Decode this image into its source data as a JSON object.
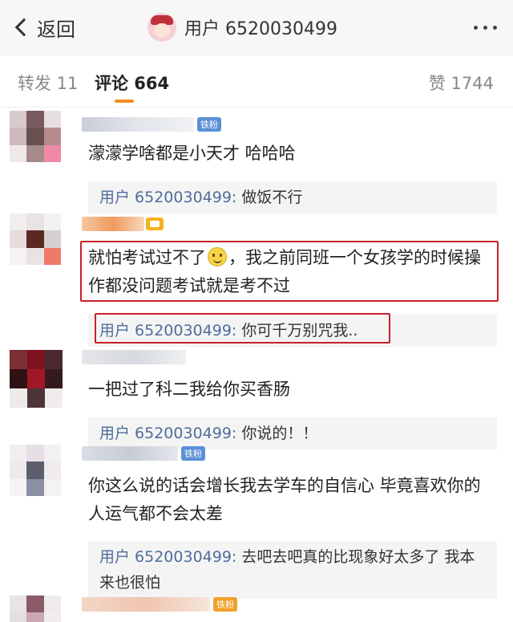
{
  "header": {
    "back_label": "返回",
    "title": "用户 6520030499"
  },
  "tabs": {
    "repost": "转发 11",
    "comment": "评论 664",
    "like": "赞 1744",
    "accent_color": "#f28c1e"
  },
  "comments": [
    {
      "badge": "铁粉",
      "text": "濛濛学啥都是小天才 哈哈哈",
      "reply_user": "用户 6520030499:",
      "reply_text": " 做饭不行"
    },
    {
      "text_before": "就怕考试过不了",
      "text_after": "，我之前同班一个女孩学的时候操作都没问题考试就是考不过",
      "reply_user": "用户 6520030499:",
      "reply_text": " 你可千万别咒我.."
    },
    {
      "text": "一把过了科二我给你买香肠",
      "reply_user": "用户 6520030499:",
      "reply_text": " 你说的！！"
    },
    {
      "badge": "铁粉",
      "text": "你这么说的话会增长我去学车的自信心 毕竟喜欢你的人运气都不会太差",
      "reply_user": "用户 6520030499:",
      "reply_text": " 去吧去吧真的比现象好太多了 我本来也很怕"
    },
    {
      "badge": "铁粉"
    }
  ],
  "icons": {
    "back": "chevron-left-icon",
    "more": "more-dots-icon",
    "emoji": "smiley-emoji-icon"
  },
  "highlight_color": "#c8202a"
}
